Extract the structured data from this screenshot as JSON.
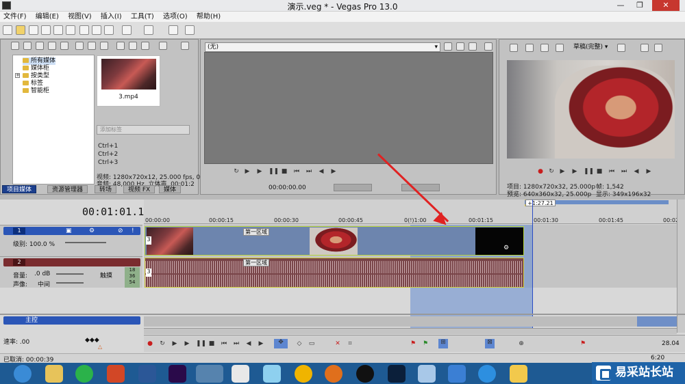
{
  "window": {
    "title": "演示.veg * - Vegas Pro 13.0"
  },
  "menu": [
    "文件(F)",
    "编辑(E)",
    "视图(V)",
    "插入(I)",
    "工具(T)",
    "选项(O)",
    "帮助(H)"
  ],
  "explorer": {
    "tree": [
      "所有媒体",
      "媒体柜",
      "按类型",
      "标签",
      "智能柜"
    ],
    "media_file": "3.mp4",
    "tag_placeholder": "添加标签",
    "shortcuts": [
      "Ctrl+1",
      "Ctrl+2",
      "Ctrl+3"
    ],
    "info_video": "视频: 1280x720x12, 25.000 fps, 0(",
    "info_audio": "音频: 48,000 Hz, 立体声, 00:01:2"
  },
  "tabs": [
    "项目媒体",
    "资源管理器",
    "转场",
    "视频 FX",
    "媒体"
  ],
  "trimmer": {
    "select_value": "(无)",
    "timecode": "00:00:00.00"
  },
  "preview": {
    "quality": "草稿(完整)",
    "project_label": "项目:",
    "project_value": "1280x720x32, 25.000p",
    "preview_label": "预览:",
    "preview_value": "640x360x32, 25.000p",
    "frame_label": "帧:",
    "frame_value": "1,542",
    "display_label": "显示:",
    "display_value": "349x196x32"
  },
  "timeline": {
    "timecode": "00:01:01.17",
    "ruler_labels": [
      "00:00:00",
      "00:00:15",
      "00:00:30",
      "00:00:45",
      "0(!)1:00",
      "00:01:15",
      "00:01:30",
      "00:01:45",
      "00:02"
    ],
    "selection_length": "+1:27.21",
    "region_label": "第一区域",
    "clip_number": "3",
    "video_track": {
      "number": "1",
      "level_label": "级别: 100.0 %"
    },
    "audio_track": {
      "number": "2",
      "volume_label": "音量:",
      "volume_value": ".0 dB",
      "pan_label": "声像:",
      "pan_value": "中间",
      "touch": "触摸",
      "meter": [
        "18",
        "36",
        "54"
      ]
    },
    "master": {
      "label": "主控"
    },
    "rate": "速率: .00",
    "end_time": "28.04",
    "right_time": "6:20"
  },
  "status": {
    "text": "已取消: 00:00:39"
  },
  "watermark": "易采站长站",
  "colors": {
    "accent": "#2b56b7",
    "video_clip": "#6d85ae",
    "audio_clip": "#794549",
    "selection": "#6a8cd2",
    "arrow": "#e02222"
  }
}
